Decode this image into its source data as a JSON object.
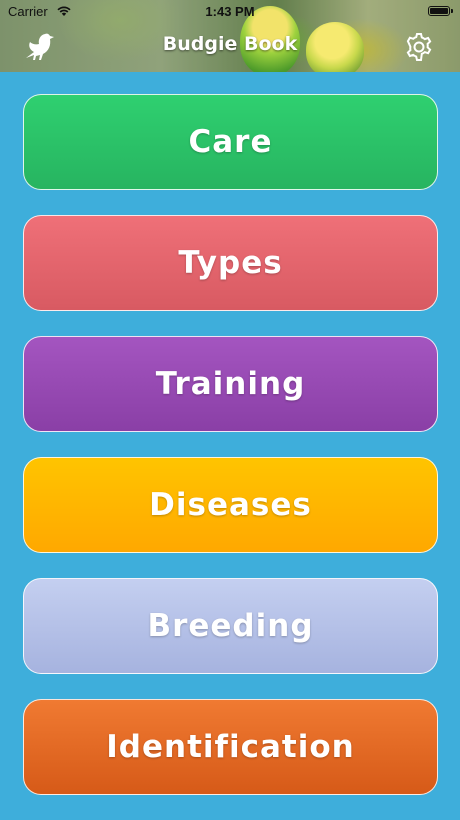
{
  "status_bar": {
    "carrier": "Carrier",
    "time": "1:43 PM",
    "wifi_icon": "wifi-icon",
    "battery_icon": "battery-icon"
  },
  "header": {
    "title": "Budgie Book",
    "left_icon": "bird-icon",
    "right_icon": "gear-icon"
  },
  "menu": {
    "items": [
      {
        "label": "Care",
        "color": "#2ecc71"
      },
      {
        "label": "Types",
        "color": "#e8636b"
      },
      {
        "label": "Training",
        "color": "#9b4bb5"
      },
      {
        "label": "Diseases",
        "color": "#ffb800"
      },
      {
        "label": "Breeding",
        "color": "#b6c2ea"
      },
      {
        "label": "Identification",
        "color": "#e8692a"
      }
    ]
  },
  "colors": {
    "background": "#3eaedb"
  }
}
